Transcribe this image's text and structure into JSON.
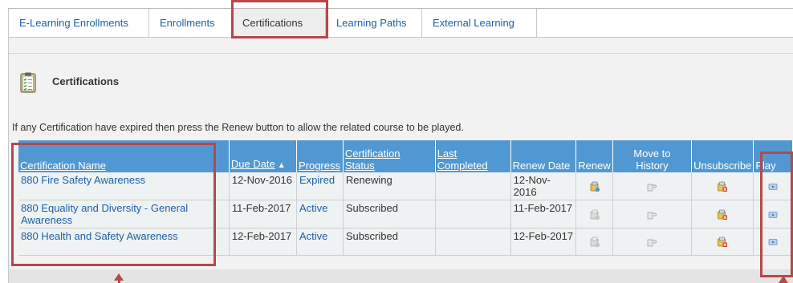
{
  "tabs": [
    {
      "label": "E-Learning Enrollments",
      "active": false
    },
    {
      "label": "Enrollments",
      "active": false
    },
    {
      "label": "Certifications",
      "active": true
    },
    {
      "label": "Learning Paths",
      "active": false
    },
    {
      "label": "External Learning",
      "active": false
    }
  ],
  "section": {
    "title": "Certifications",
    "icon": "clipboard-checklist-icon"
  },
  "info_text": "If any Certification have expired then press the Renew button to allow the related course to be played.",
  "table": {
    "headers": {
      "name": "Certification Name",
      "due_date": "Due Date",
      "sort_indicator": "▲",
      "progress": "Progress",
      "status_line1": "Certification",
      "status_line2": "Status",
      "last_line1": "Last",
      "last_line2": "Completed",
      "renew_date": "Renew Date",
      "renew": "Renew",
      "move_line1": "Move to",
      "move_line2": "History",
      "unsubscribe": "Unsubscribe",
      "play": "Play"
    },
    "rows": [
      {
        "name": "880 Fire Safety Awareness",
        "due_date": "12-Nov-2016",
        "progress": "Expired",
        "status": "Renewing",
        "last_completed": "",
        "renew_date": "12-Nov-2016"
      },
      {
        "name": "880 Equality and Diversity - General Awareness",
        "due_date": "11-Feb-2017",
        "progress": "Active",
        "status": "Subscribed",
        "last_completed": "",
        "renew_date": "11-Feb-2017"
      },
      {
        "name": "880 Health and Safety Awareness",
        "due_date": "12-Feb-2017",
        "progress": "Active",
        "status": "Subscribed",
        "last_completed": "",
        "renew_date": "12-Feb-2017"
      }
    ]
  },
  "colors": {
    "header_blue": "#5198d2",
    "link_blue": "#1d5fa8",
    "annotation_red": "#b7474a"
  }
}
